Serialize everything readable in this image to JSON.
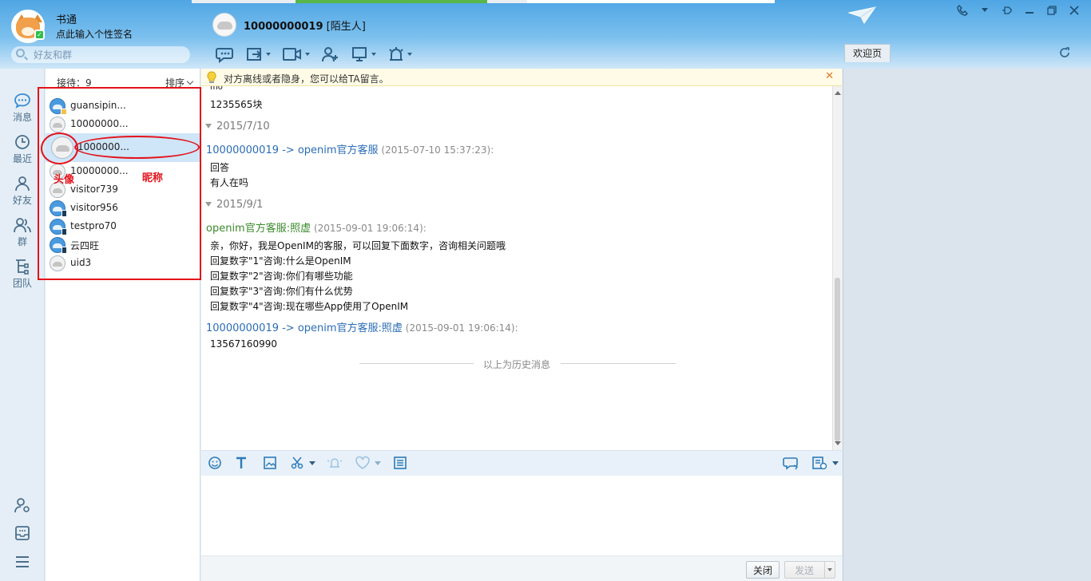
{
  "app": {
    "name": "书通",
    "signature": "点此输入个性签名"
  },
  "search": {
    "placeholder": "好友和群"
  },
  "chat_header": {
    "name": "10000000019",
    "tag": "[陌生人]"
  },
  "welcome_tab": "欢迎页",
  "rail": [
    {
      "label": "消息",
      "icon": "message-icon"
    },
    {
      "label": "最近",
      "icon": "clock-icon"
    },
    {
      "label": "好友",
      "icon": "person-icon"
    },
    {
      "label": "群",
      "icon": "group-icon"
    },
    {
      "label": "团队",
      "icon": "team-icon"
    }
  ],
  "contacts": {
    "reception_label": "接待：9",
    "sort_label": "排序",
    "items": [
      {
        "name": "guansipin...",
        "avatar": "blue"
      },
      {
        "name": "10000000...",
        "avatar": "gray"
      },
      {
        "name": "1000000...",
        "avatar": "gray"
      },
      {
        "name": "10000000...",
        "avatar": "gray"
      },
      {
        "name": "visitor739",
        "avatar": "gray"
      },
      {
        "name": "visitor956",
        "avatar": "blue"
      },
      {
        "name": "testpro70",
        "avatar": "blue"
      },
      {
        "name": "云四旺",
        "avatar": "blue"
      },
      {
        "name": "uid3",
        "avatar": "gray"
      }
    ]
  },
  "annotations": {
    "avatar": "头像",
    "nickname": "昵称"
  },
  "notice": "对方离线或者隐身，您可以给TA留言。",
  "messages": {
    "top_partial": "mo",
    "m0": "1235565块",
    "d1": "2015/7/10",
    "s1": {
      "sender": "10000000019 -> openim官方客服",
      "time": "(2015-07-10 15:37:23):"
    },
    "b1": [
      "回答",
      "有人在吗"
    ],
    "d2": "2015/9/1",
    "s2": {
      "sender": "openim官方客服:照虚",
      "time": "(2015-09-01 19:06:14):"
    },
    "b2": [
      "亲，你好，我是OpenIM的客服，可以回复下面数字，咨询相关问题哦",
      "回复数字\"1\"咨询:什么是OpenIM",
      "回复数字\"2\"咨询:你们有哪些功能",
      "回复数字\"3\"咨询:你们有什么优势",
      "回复数字\"4\"咨询:现在哪些App使用了OpenIM"
    ],
    "s3": {
      "sender": "10000000019 -> openim官方客服:照虚",
      "time": "(2015-09-01 19:06:14):"
    },
    "b3": "13567160990",
    "history": "以上为历史消息"
  },
  "buttons": {
    "close": "关闭",
    "send": "发送"
  },
  "colors": {
    "accent": "#4fa6e4",
    "annotation": "#e3121a",
    "link": "#2b6cb5"
  }
}
